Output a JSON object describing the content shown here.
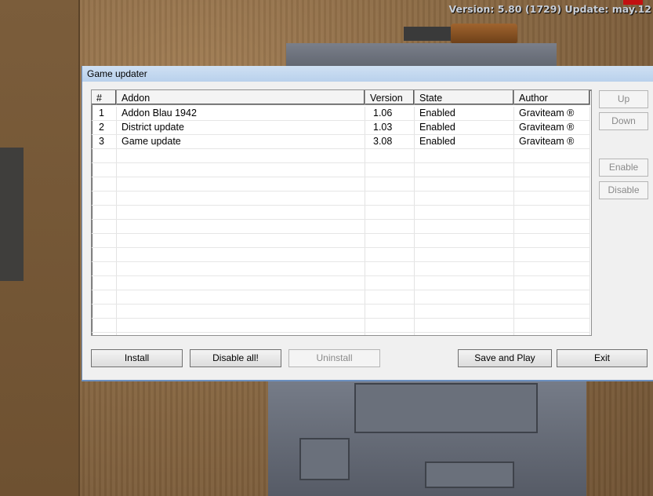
{
  "overlay": {
    "version_text": "Version: 5.80 (1729)  Update: may.12"
  },
  "window": {
    "title": "Game updater"
  },
  "table": {
    "columns": [
      "#",
      "Addon",
      "Version",
      "State",
      "Author"
    ],
    "rows": [
      [
        "1",
        "Addon Blau 1942",
        "1.06",
        "Enabled",
        "Graviteam ®"
      ],
      [
        "2",
        "District update",
        "1.03",
        "Enabled",
        "Graviteam ®"
      ],
      [
        "3",
        "Game update",
        "3.08",
        "Enabled",
        "Graviteam ®"
      ]
    ]
  },
  "side_buttons": {
    "up": "Up",
    "down": "Down",
    "enable": "Enable",
    "disable": "Disable"
  },
  "bottom_buttons": {
    "install": "Install",
    "disable_all": "Disable all!",
    "uninstall": "Uninstall",
    "save_and_play": "Save and Play",
    "exit": "Exit"
  }
}
